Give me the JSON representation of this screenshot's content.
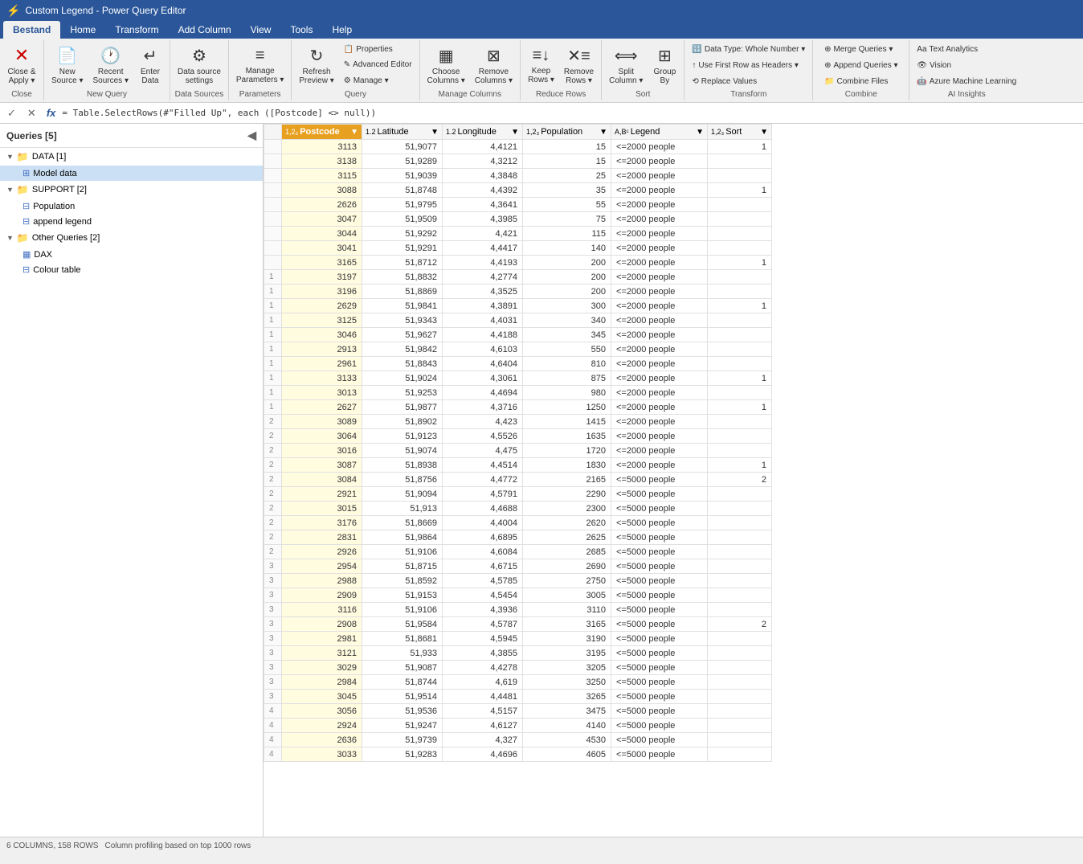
{
  "titleBar": {
    "title": "Custom Legend - Power Query Editor",
    "icon": "⚡"
  },
  "ribbonTabs": [
    "Bestand",
    "Home",
    "Transform",
    "Add Column",
    "View",
    "Tools",
    "Help"
  ],
  "activeTab": "Bestand",
  "groups": {
    "close": {
      "label": "Close",
      "buttons": [
        {
          "icon": "✕",
          "label": "Close &\nApply ▾",
          "name": "close-apply"
        }
      ]
    },
    "newQuery": {
      "label": "New Query",
      "buttons": [
        {
          "icon": "📄",
          "label": "New\nSource ▾",
          "name": "new-source"
        },
        {
          "icon": "🕐",
          "label": "Recent\nSources ▾",
          "name": "recent-sources"
        },
        {
          "icon": "↵",
          "label": "Enter\nData",
          "name": "enter-data"
        }
      ]
    },
    "dataSources": {
      "label": "Data Sources",
      "buttons": [
        {
          "icon": "⚙",
          "label": "Data source\nsettings",
          "name": "data-source-settings"
        }
      ]
    },
    "parameters": {
      "label": "Parameters",
      "buttons": [
        {
          "icon": "≡",
          "label": "Manage\nParameters ▾",
          "name": "manage-parameters"
        }
      ]
    },
    "query": {
      "label": "Query",
      "small_buttons": [
        {
          "icon": "📋",
          "label": "Properties",
          "name": "properties"
        },
        {
          "icon": "✎",
          "label": "Advanced Editor",
          "name": "advanced-editor"
        },
        {
          "icon": "⚙",
          "label": "Manage ▾",
          "name": "manage"
        }
      ],
      "buttons": [
        {
          "icon": "↻",
          "label": "Refresh\nPreview ▾",
          "name": "refresh-preview"
        }
      ]
    },
    "manageColumns": {
      "label": "Manage Columns",
      "buttons": [
        {
          "icon": "▦",
          "label": "Choose\nColumns ▾",
          "name": "choose-columns"
        },
        {
          "icon": "✕▦",
          "label": "Remove\nColumns ▾",
          "name": "remove-columns"
        }
      ]
    },
    "reduceRows": {
      "label": "Reduce Rows",
      "buttons": [
        {
          "icon": "≡↓",
          "label": "Keep\nRows ▾",
          "name": "keep-rows"
        },
        {
          "icon": "≡✕",
          "label": "Remove\nRows ▾",
          "name": "remove-rows"
        }
      ]
    },
    "sort": {
      "label": "Sort",
      "buttons": [
        {
          "icon": "↕",
          "label": "Split\nColumn ▾",
          "name": "split-column"
        },
        {
          "icon": "⊞",
          "label": "Group\nBy",
          "name": "group-by"
        }
      ]
    },
    "transform": {
      "label": "Transform",
      "small_buttons": [
        {
          "icon": "🔢",
          "label": "Data Type: Whole Number ▾",
          "name": "data-type"
        },
        {
          "icon": "↑",
          "label": "Use First Row as Headers ▾",
          "name": "use-first-row"
        },
        {
          "icon": "⟲",
          "label": "Replace Values",
          "name": "replace-values"
        }
      ]
    },
    "combine": {
      "label": "Combine",
      "small_buttons": [
        {
          "icon": "⊕",
          "label": "Merge Queries ▾",
          "name": "merge-queries"
        },
        {
          "icon": "⊕",
          "label": "Append Queries ▾",
          "name": "append-queries"
        },
        {
          "icon": "📁",
          "label": "Combine Files",
          "name": "combine-files"
        }
      ]
    },
    "aiInsights": {
      "label": "AI Insights",
      "small_buttons": [
        {
          "icon": "Aa",
          "label": "Text Analytics",
          "name": "text-analytics"
        },
        {
          "icon": "👁",
          "label": "Vision",
          "name": "vision"
        },
        {
          "icon": "🤖",
          "label": "Azure Machine Learning",
          "name": "azure-ml"
        }
      ]
    }
  },
  "formulaBar": {
    "checkMark": "✓",
    "crossMark": "✕",
    "fx": "fx",
    "formula": "= Table.SelectRows(#\"Filled Up\", each ([Postcode] <> null))"
  },
  "sidebar": {
    "title": "Queries [5]",
    "collapseIcon": "◀",
    "groups": [
      {
        "name": "DATA [1]",
        "type": "yellow",
        "expanded": true,
        "items": [
          {
            "name": "Model data",
            "type": "table",
            "active": true
          }
        ]
      },
      {
        "name": "SUPPORT [2]",
        "type": "yellow",
        "expanded": true,
        "items": [
          {
            "name": "Population",
            "type": "table"
          },
          {
            "name": "append legend",
            "type": "table"
          }
        ]
      },
      {
        "name": "Other Queries [2]",
        "type": "blue",
        "expanded": true,
        "items": [
          {
            "name": "DAX",
            "type": "grid"
          },
          {
            "name": "Colour table",
            "type": "table"
          }
        ]
      }
    ]
  },
  "columns": [
    {
      "name": "Postcode",
      "type": "1,2₃",
      "active": true
    },
    {
      "name": "Latitude",
      "type": "1.2"
    },
    {
      "name": "Longitude",
      "type": "1.2"
    },
    {
      "name": "Population",
      "type": "1,2₃"
    },
    {
      "name": "Legend",
      "type": "A,B_C"
    },
    {
      "name": "Sort",
      "type": "1,2₃"
    }
  ],
  "rows": [
    [
      "",
      "3113",
      "51,9077",
      "4,4121",
      "15",
      "<=2000 people",
      "1"
    ],
    [
      "",
      "3138",
      "51,9289",
      "4,3212",
      "15",
      "<=2000 people",
      ""
    ],
    [
      "",
      "3115",
      "51,9039",
      "4,3848",
      "25",
      "<=2000 people",
      ""
    ],
    [
      "",
      "3088",
      "51,8748",
      "4,4392",
      "35",
      "<=2000 people",
      "1"
    ],
    [
      "",
      "2626",
      "51,9795",
      "4,3641",
      "55",
      "<=2000 people",
      ""
    ],
    [
      "",
      "3047",
      "51,9509",
      "4,3985",
      "75",
      "<=2000 people",
      ""
    ],
    [
      "",
      "3044",
      "51,9292",
      "4,421",
      "115",
      "<=2000 people",
      ""
    ],
    [
      "",
      "3041",
      "51,9291",
      "4,4417",
      "140",
      "<=2000 people",
      ""
    ],
    [
      "",
      "3165",
      "51,8712",
      "4,4193",
      "200",
      "<=2000 people",
      "1"
    ],
    [
      "1",
      "3197",
      "51,8832",
      "4,2774",
      "200",
      "<=2000 people",
      ""
    ],
    [
      "1",
      "3196",
      "51,8869",
      "4,3525",
      "200",
      "<=2000 people",
      ""
    ],
    [
      "1",
      "2629",
      "51,9841",
      "4,3891",
      "300",
      "<=2000 people",
      "1"
    ],
    [
      "1",
      "3125",
      "51,9343",
      "4,4031",
      "340",
      "<=2000 people",
      ""
    ],
    [
      "1",
      "3046",
      "51,9627",
      "4,4188",
      "345",
      "<=2000 people",
      ""
    ],
    [
      "1",
      "2913",
      "51,9842",
      "4,6103",
      "550",
      "<=2000 people",
      ""
    ],
    [
      "1",
      "2961",
      "51,8843",
      "4,6404",
      "810",
      "<=2000 people",
      ""
    ],
    [
      "1",
      "3133",
      "51,9024",
      "4,3061",
      "875",
      "<=2000 people",
      "1"
    ],
    [
      "1",
      "3013",
      "51,9253",
      "4,4694",
      "980",
      "<=2000 people",
      ""
    ],
    [
      "1",
      "2627",
      "51,9877",
      "4,3716",
      "1250",
      "<=2000 people",
      "1"
    ],
    [
      "2",
      "3089",
      "51,8902",
      "4,423",
      "1415",
      "<=2000 people",
      ""
    ],
    [
      "2",
      "3064",
      "51,9123",
      "4,5526",
      "1635",
      "<=2000 people",
      ""
    ],
    [
      "2",
      "3016",
      "51,9074",
      "4,475",
      "1720",
      "<=2000 people",
      ""
    ],
    [
      "2",
      "3087",
      "51,8938",
      "4,4514",
      "1830",
      "<=2000 people",
      "1"
    ],
    [
      "2",
      "3084",
      "51,8756",
      "4,4772",
      "2165",
      "<=5000 people",
      "2"
    ],
    [
      "2",
      "2921",
      "51,9094",
      "4,5791",
      "2290",
      "<=5000 people",
      ""
    ],
    [
      "2",
      "3015",
      "51,913",
      "4,4688",
      "2300",
      "<=5000 people",
      ""
    ],
    [
      "2",
      "3176",
      "51,8669",
      "4,4004",
      "2620",
      "<=5000 people",
      ""
    ],
    [
      "2",
      "2831",
      "51,9864",
      "4,6895",
      "2625",
      "<=5000 people",
      ""
    ],
    [
      "2",
      "2926",
      "51,9106",
      "4,6084",
      "2685",
      "<=5000 people",
      ""
    ],
    [
      "3",
      "2954",
      "51,8715",
      "4,6715",
      "2690",
      "<=5000 people",
      ""
    ],
    [
      "3",
      "2988",
      "51,8592",
      "4,5785",
      "2750",
      "<=5000 people",
      ""
    ],
    [
      "3",
      "2909",
      "51,9153",
      "4,5454",
      "3005",
      "<=5000 people",
      ""
    ],
    [
      "3",
      "3116",
      "51,9106",
      "4,3936",
      "3110",
      "<=5000 people",
      ""
    ],
    [
      "3",
      "2908",
      "51,9584",
      "4,5787",
      "3165",
      "<=5000 people",
      "2"
    ],
    [
      "3",
      "2981",
      "51,8681",
      "4,5945",
      "3190",
      "<=5000 people",
      ""
    ],
    [
      "3",
      "3121",
      "51,933",
      "4,3855",
      "3195",
      "<=5000 people",
      ""
    ],
    [
      "3",
      "3029",
      "51,9087",
      "4,4278",
      "3205",
      "<=5000 people",
      ""
    ],
    [
      "3",
      "2984",
      "51,8744",
      "4,619",
      "3250",
      "<=5000 people",
      ""
    ],
    [
      "3",
      "3045",
      "51,9514",
      "4,4481",
      "3265",
      "<=5000 people",
      ""
    ],
    [
      "4",
      "3056",
      "51,9536",
      "4,5157",
      "3475",
      "<=5000 people",
      ""
    ],
    [
      "4",
      "2924",
      "51,9247",
      "4,6127",
      "4140",
      "<=5000 people",
      ""
    ],
    [
      "4",
      "2636",
      "51,9739",
      "4,327",
      "4530",
      "<=5000 people",
      ""
    ],
    [
      "4",
      "3033",
      "51,9283",
      "4,4696",
      "4605",
      "<=5000 people",
      ""
    ]
  ],
  "statusBar": {
    "columns": "6 COLUMNS, 158 ROWS",
    "profiling": "Column profiling based on top 1000 rows"
  }
}
